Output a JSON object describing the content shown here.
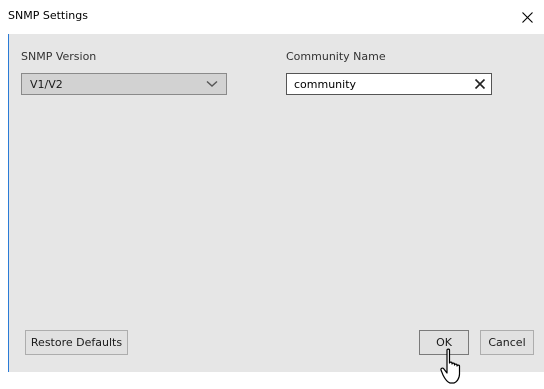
{
  "window": {
    "title": "SNMP Settings"
  },
  "form": {
    "snmp_version": {
      "label": "SNMP Version",
      "selected": "V1/V2"
    },
    "community": {
      "label": "Community Name",
      "value": "community"
    }
  },
  "buttons": {
    "restore_defaults": "Restore Defaults",
    "ok": "OK",
    "cancel": "Cancel"
  },
  "icons": {
    "close": "close-icon",
    "dropdown": "chevron-down-icon",
    "clear": "clear-icon",
    "cursor": "mouse-pointer-icon"
  },
  "colors": {
    "accent_border": "#2b7bd6",
    "client_bg": "#e6e6e6"
  }
}
